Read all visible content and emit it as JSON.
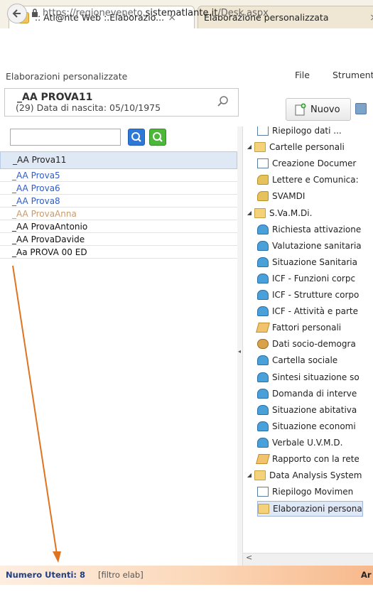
{
  "browser": {
    "tabs": [
      {
        "title": ".: Atl@nte Web :.Elaborazio...",
        "close": "×"
      },
      {
        "title": "Elaborazione personalizzata",
        "close": "×"
      }
    ],
    "url_prefix": "https://regioneveneto.",
    "url_domain": "sistematlante.it",
    "url_path": "/Desk.aspx"
  },
  "header": {
    "panel_title": "Elaborazioni personalizzate",
    "patient_name": "_AA PROVA11",
    "patient_sub": "(29)  Data di nascita: 05/10/1975",
    "menu": [
      "File",
      "Strument"
    ],
    "new_button": "Nuovo"
  },
  "patients": [
    {
      "name": "_AA Prova11",
      "style": "selected"
    },
    {
      "name": "_AA Prova5",
      "style": "blue"
    },
    {
      "name": "_AA Prova6",
      "style": "blue"
    },
    {
      "name": "_AA Prova8",
      "style": "blue"
    },
    {
      "name": "_AA ProvaAnna",
      "style": "tan"
    },
    {
      "name": "_AA ProvaAntonio",
      "style": "black"
    },
    {
      "name": "_AA ProvaDavide",
      "style": "black"
    },
    {
      "name": "_Aa PROVA 00 ED",
      "style": "black"
    }
  ],
  "tree": {
    "items": [
      {
        "label": "Riepilogo dati ... ",
        "icon": "doc-icon",
        "level": 1
      },
      {
        "label": "Cartelle personali",
        "icon": "folder-icon",
        "level": 0
      },
      {
        "label": "Creazione Documer",
        "icon": "doc-icon",
        "level": 1
      },
      {
        "label": "Lettere e Comunica:",
        "icon": "share-icon",
        "level": 1
      },
      {
        "label": "SVAMDI",
        "icon": "share-icon",
        "level": 1
      },
      {
        "label": "S.Va.M.Di.",
        "icon": "folder-icon",
        "level": 0
      },
      {
        "label": "Richiesta attivazione",
        "icon": "person-icon",
        "level": 1
      },
      {
        "label": "Valutazione sanitaria",
        "icon": "person-icon",
        "level": 1
      },
      {
        "label": "Situazione Sanitaria",
        "icon": "person-icon",
        "level": 1
      },
      {
        "label": "ICF - Funzioni corpc",
        "icon": "person-icon",
        "level": 1
      },
      {
        "label": "ICF - Strutture corpo",
        "icon": "person-icon",
        "level": 1
      },
      {
        "label": "ICF - Attività e parte",
        "icon": "person-icon",
        "level": 1
      },
      {
        "label": "Fattori personali",
        "icon": "edit-icon",
        "level": 1
      },
      {
        "label": "Dati socio-demogra",
        "icon": "group-icon",
        "level": 1
      },
      {
        "label": "Cartella sociale",
        "icon": "person-icon",
        "level": 1
      },
      {
        "label": "Sintesi situazione so",
        "icon": "person-icon",
        "level": 1
      },
      {
        "label": "Domanda di interve",
        "icon": "person-icon",
        "level": 1
      },
      {
        "label": "Situazione abitativa",
        "icon": "person-icon",
        "level": 1
      },
      {
        "label": "Situazione economi",
        "icon": "person-icon",
        "level": 1
      },
      {
        "label": "Verbale U.V.M.D.",
        "icon": "person-icon",
        "level": 1
      },
      {
        "label": "Rapporto con la rete",
        "icon": "edit-icon",
        "level": 1
      },
      {
        "label": "Data Analysis System",
        "icon": "folder-icon",
        "level": 0
      },
      {
        "label": "Riepilogo Movimen",
        "icon": "doc-icon",
        "level": 1
      },
      {
        "label": "Elaborazioni persona",
        "icon": "folder-icon",
        "level": 1,
        "selected": true
      }
    ]
  },
  "status": {
    "count_label": "Numero Utenti: 8",
    "filter_label": "[filtro elab]",
    "right_label": "Ar"
  },
  "colors": {
    "annotation_arrow": "#e07320",
    "link_blue": "#2f5cc8",
    "selection": "#dfe8f5"
  }
}
